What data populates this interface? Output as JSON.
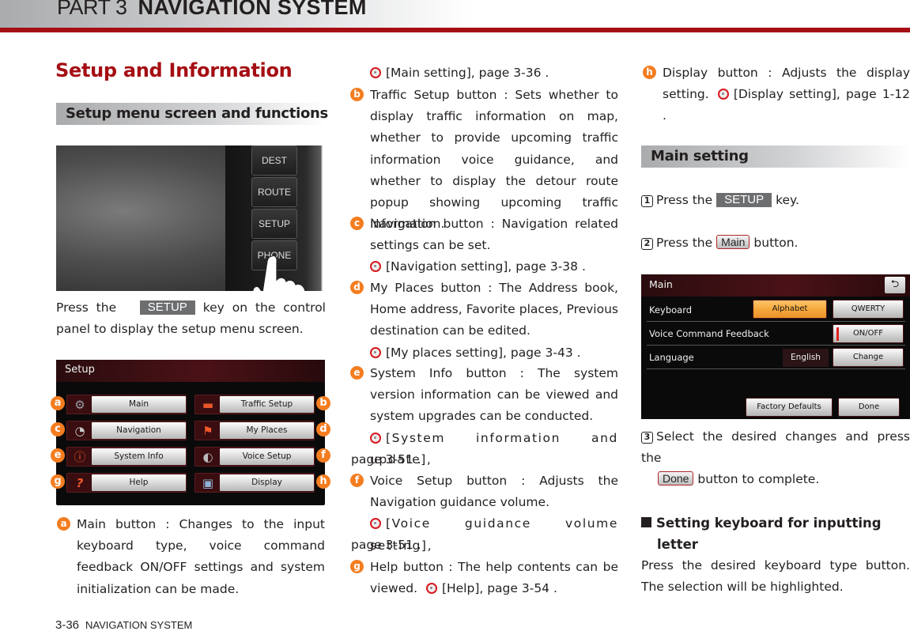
{
  "header": {
    "part": "PART 3",
    "title": "NAVIGATION SYSTEM"
  },
  "section_title": "Setup and Information",
  "subheads": {
    "setup_menu": "Setup menu screen and functions",
    "main_setting": "Main setting"
  },
  "photo": {
    "keys": [
      "DEST",
      "ROUTE",
      "SETUP",
      "PHONE"
    ]
  },
  "intro": {
    "before": "Press the",
    "key": "SETUP",
    "after": "key on the control panel to display the setup menu screen."
  },
  "setup_screen": {
    "title": "Setup",
    "buttons": [
      {
        "badge": "a",
        "label": "Main",
        "icon": "gear-icon",
        "glyph": "⚙"
      },
      {
        "badge": "b",
        "label": "Traffic Setup",
        "icon": "car-icon",
        "glyph": "🚗"
      },
      {
        "badge": "c",
        "label": "Navigation",
        "icon": "clock-icon",
        "glyph": "◔"
      },
      {
        "badge": "d",
        "label": "My Places",
        "icon": "flag-icon",
        "glyph": "⚑"
      },
      {
        "badge": "e",
        "label": "System Info",
        "icon": "info-icon",
        "glyph": "ⓘ"
      },
      {
        "badge": "f",
        "label": "Voice Setup",
        "icon": "headset-icon",
        "glyph": "🎧"
      },
      {
        "badge": "g",
        "label": "Help",
        "icon": "help-icon",
        "glyph": "?"
      },
      {
        "badge": "h",
        "label": "Display",
        "icon": "monitor-icon",
        "glyph": "🖥"
      }
    ]
  },
  "descriptions": {
    "a": {
      "badge": "a",
      "text": "Main button : Changes to the input keyboard type, voice command feedback ON/OFF settings and system initialization can be made.",
      "ref": "[Main setting], page 3-36 ."
    },
    "b": {
      "badge": "b",
      "text": "Traffic Setup button : Sets whether to display traffic information on map, whether to provide upcoming traffic information voice guidance, and whether to display the detour route popup showing upcoming traffic information."
    },
    "c": {
      "badge": "c",
      "text": "Navigation button : Navigation related settings can be set.",
      "ref": "[Navigation setting], page 3-38 ."
    },
    "d": {
      "badge": "d",
      "text": "My Places button : The Address book, Home address, Favorite places, Previous destination can be edited.",
      "ref": "[My places setting], page 3-43 ."
    },
    "e": {
      "badge": "e",
      "text": "System Info button : The system version information can be viewed and system upgrades can be conducted.",
      "ref": "[System information and update],",
      "ref_cont": "page 3-51 ."
    },
    "f": {
      "badge": "f",
      "text": "Voice Setup button : Adjusts the Navigation guidance volume.",
      "ref": "[Voice guidance volume setting],",
      "ref_cont": "page 3-51 ."
    },
    "g": {
      "badge": "g",
      "text": "Help button : The help contents can be viewed.",
      "ref": "[Help], page 3-54 ."
    },
    "h": {
      "badge": "h",
      "text": "Display button : Adjusts the display setting.",
      "ref": "[Display setting], page 1-12 ."
    }
  },
  "steps": [
    {
      "num": "1",
      "before": "Press the",
      "key": "SETUP",
      "after": "key."
    },
    {
      "num": "2",
      "before": "Press the",
      "key": "Main",
      "after": "button."
    },
    {
      "num": "3",
      "before": "Select the desired changes and press the",
      "key": "Done",
      "after": "button to complete."
    }
  ],
  "main_screen": {
    "title": "Main",
    "back_label": "⮌",
    "rows": [
      {
        "label": "Keyboard",
        "options": [
          "Alphabet",
          "QWERTY"
        ],
        "selected": "Alphabet"
      },
      {
        "label": "Voice Command Feedback",
        "button": "ON/OFF",
        "state": "OFF"
      },
      {
        "label": "Language",
        "value": "English",
        "button": "Change"
      }
    ],
    "factory_defaults": "Factory Defaults",
    "done": "Done"
  },
  "keyboard_section": {
    "heading_line1": "Setting keyboard for inputting",
    "heading_line2": "letter",
    "body": "Press the desired keyboard type button. The selection will be highlighted."
  },
  "footer": {
    "page": "3-36",
    "label": "NAVIGATION SYSTEM"
  }
}
